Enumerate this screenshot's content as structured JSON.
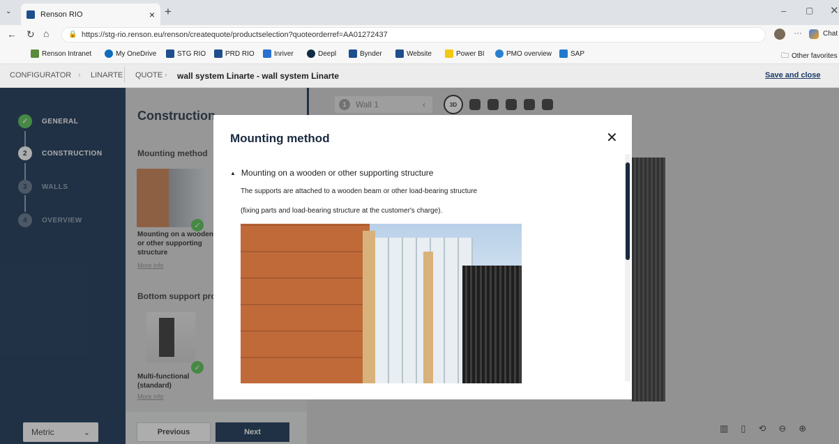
{
  "browser": {
    "tab_title": "Renson RIO",
    "tab_close": "×",
    "new_tab": "+",
    "url": "https://stg-rio.renson.eu/renson/createquote/productselection?quoteorderref=AA01272437",
    "chat_label": "Chat",
    "favorites": [
      "Renson Intranet",
      "My OneDrive",
      "STG RIO",
      "PRD RIO",
      "Inriver",
      "Deepl",
      "Bynder",
      "Website",
      "Power BI",
      "PMO overview",
      "SAP"
    ],
    "other_favorites": "Other favorites"
  },
  "header": {
    "crumb1": "CONFIGURATOR",
    "crumb2": "LINARTE",
    "crumb3": "QUOTE",
    "title": "wall system Linarte - wall system Linarte",
    "save_close": "Save and close"
  },
  "steps": [
    {
      "num": "✓",
      "label": "GENERAL"
    },
    {
      "num": "2",
      "label": "CONSTRUCTION"
    },
    {
      "num": "3",
      "label": "WALLS"
    },
    {
      "num": "4",
      "label": "OVERVIEW"
    }
  ],
  "main": {
    "title": "Construction",
    "mounting_label": "Mounting method",
    "option1": "Mounting on a wooden or other supporting structure",
    "more_info": "More info",
    "bottom_label": "Bottom support pro",
    "option2": "Multi-functional (standard)",
    "more_info2": "More info",
    "unit": "Metric",
    "prev": "Previous",
    "next": "Next"
  },
  "viewer": {
    "wall": "Wall 1",
    "num": "1"
  },
  "modal": {
    "title": "Mounting method",
    "section": "Mounting on a wooden or other supporting structure",
    "line1": "The supports are attached to a wooden beam or other load-bearing structure",
    "line2": "(fixing parts and load-bearing structure at the customer's charge)."
  }
}
